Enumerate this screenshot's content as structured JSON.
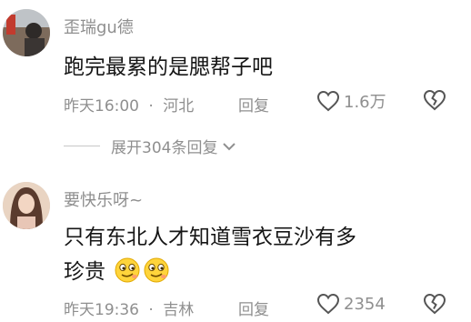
{
  "comments": [
    {
      "username": "歪瑞gu德",
      "text": "跑完最累的是腮帮子吧",
      "time": "昨天16:00",
      "location": "河北",
      "reply_label": "回复",
      "likes": "1.6万",
      "expand_label": "展开304条回复"
    },
    {
      "username": "要快乐呀~",
      "text_line1": "只有东北人才知道雪衣豆沙有多",
      "text_line2": "珍贵",
      "time": "昨天19:36",
      "location": "吉林",
      "reply_label": "回复",
      "likes": "2354"
    }
  ],
  "separator": "·",
  "colors": {
    "meta_gray": "#8f8f8f",
    "text": "#161616",
    "emoji_yellow": "#ffd43b"
  }
}
